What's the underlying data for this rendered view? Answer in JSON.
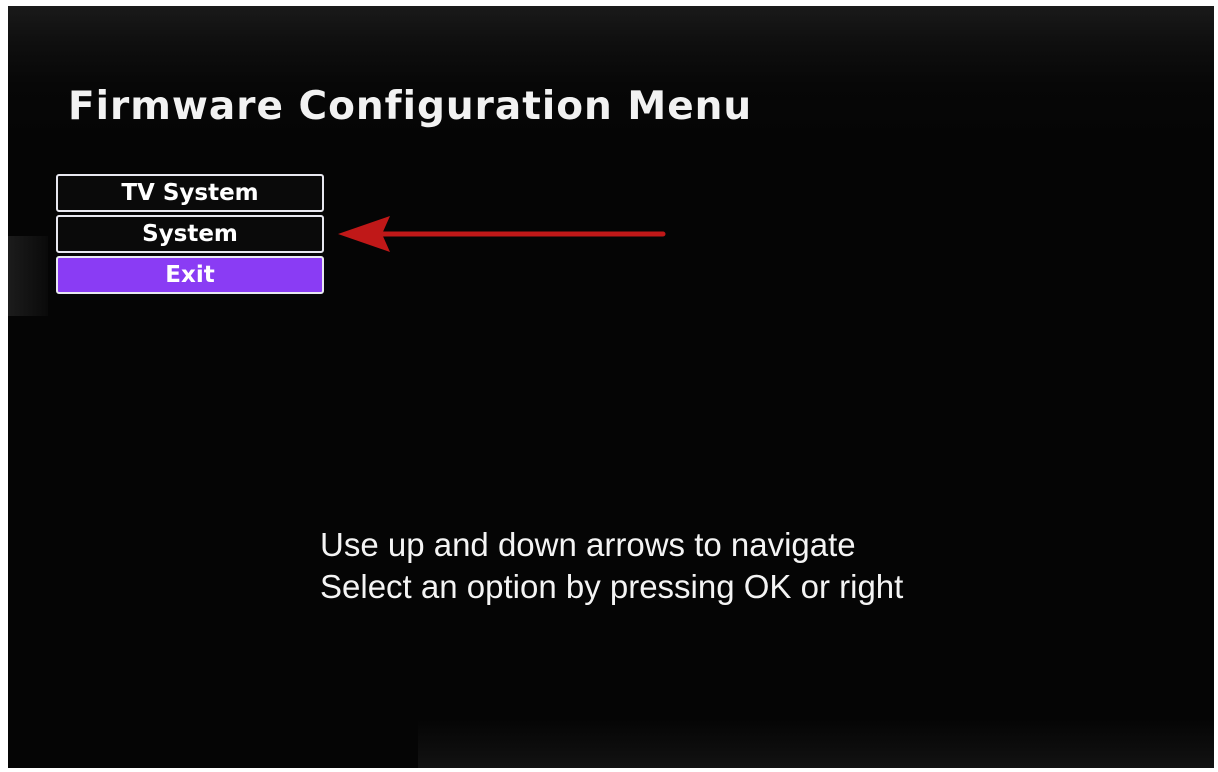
{
  "screen": {
    "title": "Firmware Configuration Menu"
  },
  "menu": {
    "items": [
      {
        "label": "TV System",
        "selected": false
      },
      {
        "label": "System",
        "selected": false
      },
      {
        "label": "Exit",
        "selected": true
      }
    ],
    "highlight_color": "#8a3cf4"
  },
  "annotation": {
    "arrow_icon": "left-arrow",
    "arrow_color": "#c01818"
  },
  "help": {
    "line1": "Use up and down arrows to navigate",
    "line2": "Select an option by pressing OK or right"
  }
}
